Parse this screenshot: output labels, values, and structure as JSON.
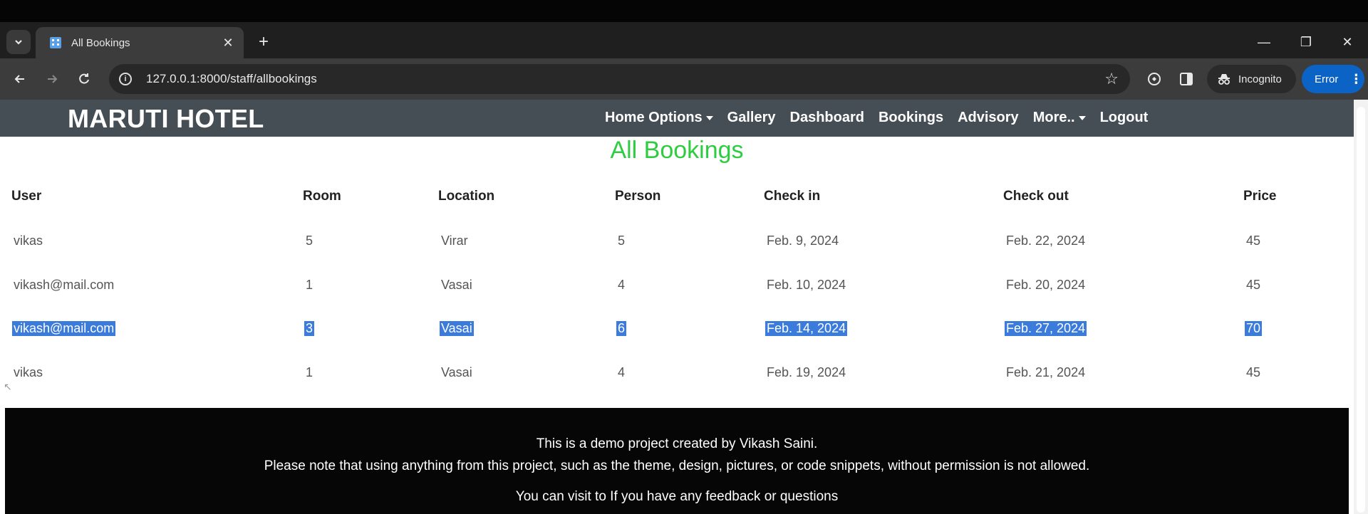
{
  "browser": {
    "tab_title": "All Bookings",
    "url": "127.0.0.1:8000/staff/allbookings",
    "incognito_label": "Incognito",
    "error_label": "Error"
  },
  "navbar": {
    "brand": "MARUTI HOTEL",
    "links": [
      "Home Options",
      "Gallery",
      "Dashboard",
      "Bookings",
      "Advisory",
      "More..",
      "Logout"
    ]
  },
  "page": {
    "heading": "All Bookings"
  },
  "table": {
    "headers": [
      "User",
      "Room",
      "Location",
      "Person",
      "Check in",
      "Check out",
      "Price"
    ],
    "rows": [
      [
        "vikas",
        "5",
        "Virar",
        "5",
        "Feb. 9, 2024",
        "Feb. 22, 2024",
        "45"
      ],
      [
        "vikash@mail.com",
        "1",
        "Vasai",
        "4",
        "Feb. 10, 2024",
        "Feb. 20, 2024",
        "45"
      ],
      [
        "vikash@mail.com",
        "3",
        "Vasai",
        "6",
        "Feb. 14, 2024",
        "Feb. 27, 2024",
        "70"
      ],
      [
        "vikas",
        "1",
        "Vasai",
        "4",
        "Feb. 19, 2024",
        "Feb. 21, 2024",
        "45"
      ]
    ],
    "selected_row": 2
  },
  "footer": {
    "line1": "This is a demo project created by Vikash Saini.",
    "line2": "Please note that using anything from this project, such as the theme, design, pictures, or code snippets, without permission is not allowed.",
    "line3": "You can visit to If you have any feedback or questions"
  },
  "colors": {
    "navbar_bg": "#454d55",
    "heading_green": "#2ecc40",
    "selection_blue": "#3b7bdc",
    "error_blue": "#0b63c6"
  }
}
